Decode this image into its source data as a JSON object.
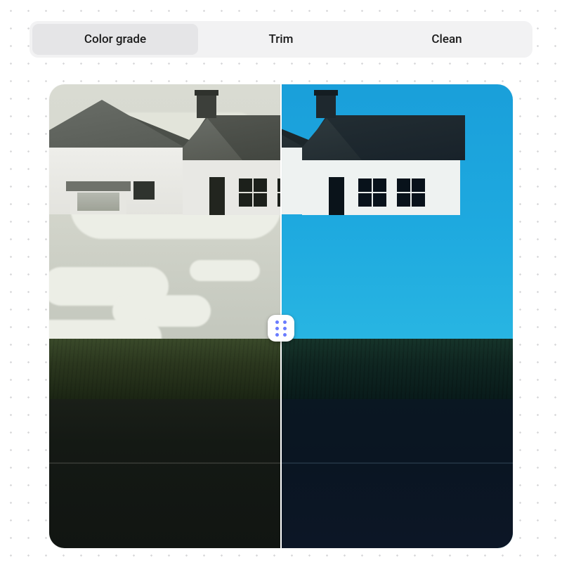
{
  "tabs": {
    "items": [
      {
        "label": "Color grade",
        "active": true
      },
      {
        "label": "Trim",
        "active": false
      },
      {
        "label": "Clean",
        "active": false
      }
    ]
  },
  "comparison": {
    "split_percent": 50,
    "handle_icon": "grip-dots-icon",
    "handle_dot_color": "#6a7cff"
  }
}
